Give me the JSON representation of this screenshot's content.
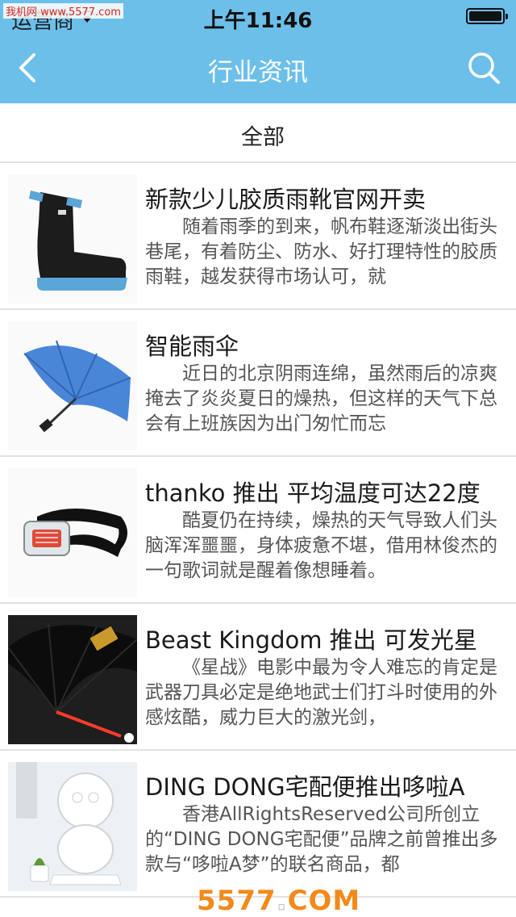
{
  "status_bar": {
    "watermark": "我机网 www.5577.com",
    "carrier": "运营商",
    "time": "上午11:46"
  },
  "nav": {
    "title": "行业资讯"
  },
  "filter": {
    "label": "全部"
  },
  "articles": [
    {
      "title": "新款少儿胶质雨靴官网开卖",
      "summary": "随着雨季的到来，帆布鞋逐渐淡出街头巷尾，有着防尘、防水、好打理特性的胶质雨鞋，越发获得市场认可，就",
      "thumb_icon": "rain-boot-image"
    },
    {
      "title": "智能雨伞",
      "summary": "近日的北京阴雨连绵，虽然雨后的凉爽掩去了炎炎夏日的燥热，但这样的天气下总会有上班族因为出门匆忙而忘",
      "thumb_icon": "umbrella-image"
    },
    {
      "title": "thanko 推出 平均温度可达22度",
      "summary": "酷夏仍在持续，燥热的天气导致人们头脑浑浑噩噩，身体疲惫不堪，借用林俊杰的一句歌词就是醒着像想睡着。",
      "thumb_icon": "neck-cooler-image"
    },
    {
      "title": "Beast Kingdom 推出 可发光星",
      "summary": "《星战》电影中最为令人难忘的肯定是武器刀具必定是绝地武士们打斗时使用的外感炫酷，威力巨大的激光剑，",
      "thumb_icon": "lightsaber-umbrella-image"
    },
    {
      "title": "DING DONG宅配便推出哆啦A",
      "summary": "香港AllRightsReserved公司所创立的“DING DONG宅配便”品牌之前曾推出多款与“哆啦A梦”的联名商品，都",
      "thumb_icon": "doraemon-figure-image"
    }
  ],
  "bottom_watermark": {
    "part1": "5577",
    "part2": ".",
    "part3": "COM"
  },
  "colors": {
    "nav_background": "#6cbfe9",
    "divider": "#e2e2e2"
  }
}
